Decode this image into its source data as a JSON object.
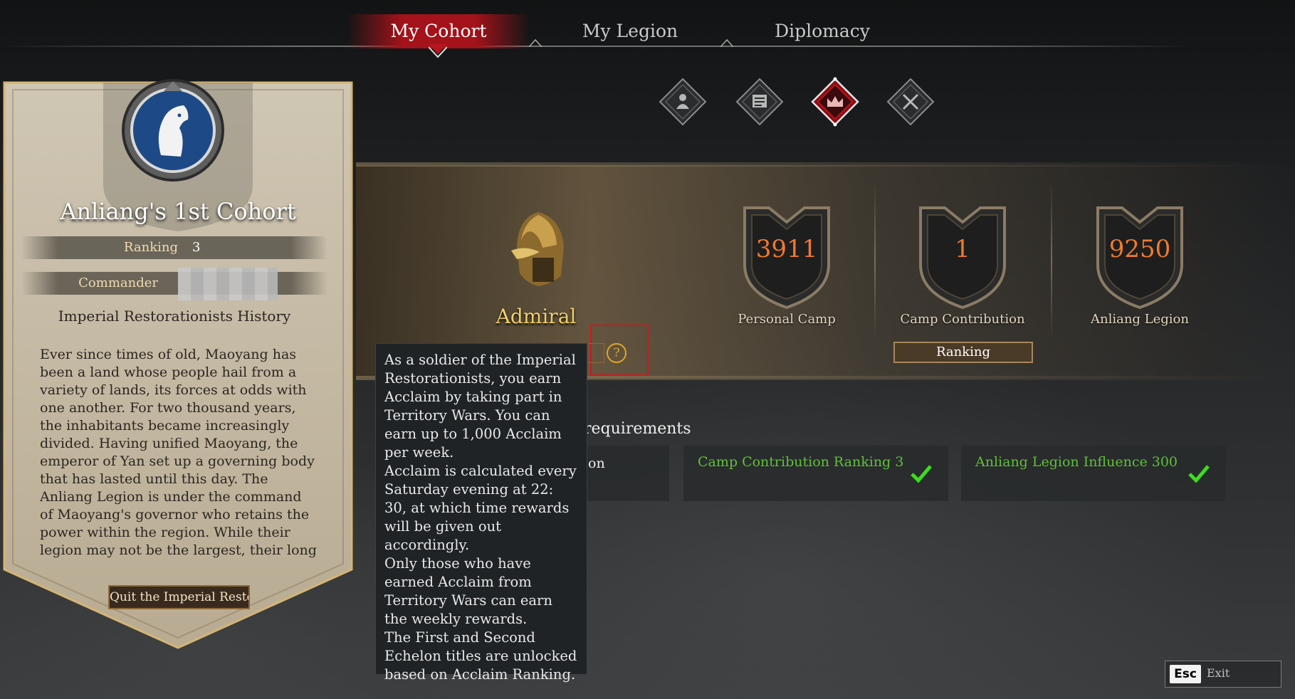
{
  "tabs": [
    {
      "label": "My Cohort",
      "active": true
    },
    {
      "label": "My Legion",
      "active": false
    },
    {
      "label": "Diplomacy",
      "active": false
    }
  ],
  "category_icons": [
    {
      "icon": "person-icon",
      "active": false
    },
    {
      "icon": "document-icon",
      "active": false
    },
    {
      "icon": "crown-icon",
      "active": true
    },
    {
      "icon": "crossed-swords-icon",
      "active": false
    }
  ],
  "cohort": {
    "name": "Anliang's 1st Cohort",
    "ranking_label": "Ranking",
    "ranking_value": "3",
    "commander_label": "Commander",
    "history_title": "Imperial Restorationists History",
    "history_text": "Ever since times of old, Maoyang has been a land whose people hail from a variety of lands, its forces at odds with one another. For two thousand years, the inhabitants became increasingly divided. Having unified Maoyang, the emperor of Yan set up a governing body that has lasted until this day. The Anliang Legion is under the command of Maoyang's governor who retains the power within the region. While their legion may not be the largest, their long life in the desert",
    "quit_label": "Quit the Imperial Restorationists"
  },
  "rank": {
    "title": "Admiral",
    "help_symbol": "?"
  },
  "stats": [
    {
      "value": "3911",
      "label": "Personal Camp"
    },
    {
      "value": "1",
      "label": "Camp Contribution"
    },
    {
      "value": "9250",
      "label": "Anliang Legion"
    }
  ],
  "ranking_button": "Ranking",
  "requirements": {
    "title_visible": "requirements",
    "partial_card_text": "on",
    "items": [
      {
        "text": "Camp Contribution Ranking 3",
        "met": true
      },
      {
        "text": "Anliang Legion Influence 300",
        "met": true
      }
    ]
  },
  "tooltip": {
    "text": "As a soldier of the Imperial Restorationists, you earn Acclaim by taking part in Territory Wars. You can earn up to 1,000 Acclaim per week.\nAcclaim is calculated every Saturday evening at 22: 30, at which time rewards will be given out accordingly.\nOnly those who have earned Acclaim from Territory Wars can earn the weekly rewards.\nThe First and Second Echelon titles are unlocked based on Acclaim Ranking."
  },
  "esc": {
    "key": "Esc",
    "label": "Exit"
  },
  "colors": {
    "accent_red": "#a4121a",
    "stat_orange": "#f07a2e",
    "rank_gold": "#f0cf6a",
    "req_green": "#5fc13a"
  }
}
